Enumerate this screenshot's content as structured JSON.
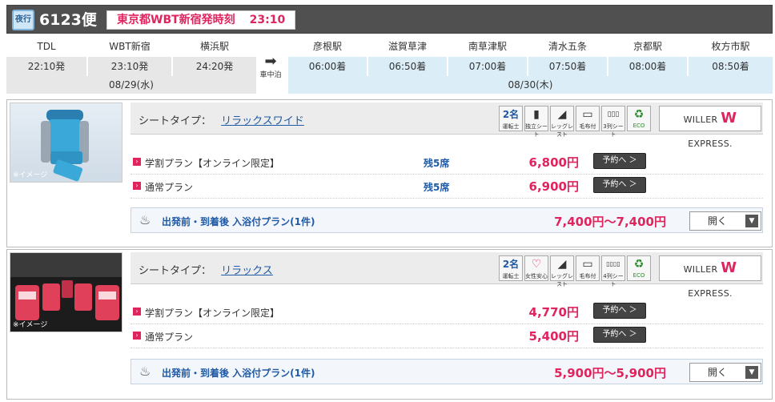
{
  "header": {
    "badge": "夜行",
    "flight": "6123便",
    "route": "東京都WBT新宿発時刻",
    "dep_time": "23:10"
  },
  "stops_dep": [
    {
      "name": "TDL",
      "time": "22:10発"
    },
    {
      "name": "WBT新宿",
      "time": "23:10発"
    },
    {
      "name": "横浜駅",
      "time": "24:20発"
    }
  ],
  "stops_arr": [
    {
      "name": "彦根駅",
      "time": "06:00着"
    },
    {
      "name": "滋賀草津",
      "time": "06:50着"
    },
    {
      "name": "南草津駅",
      "time": "07:00着"
    },
    {
      "name": "清水五条",
      "time": "07:50着"
    },
    {
      "name": "京都駅",
      "time": "08:00着"
    },
    {
      "name": "枚方市駅",
      "time": "08:50着"
    }
  ],
  "dep_date": "08/29(水)",
  "arr_date": "08/30(木)",
  "overnight_label": "車中泊",
  "image_caption": "※イメージ",
  "seat_type_label": "シートタイプ：",
  "reserve_label": "予約へ ＞",
  "open_label": "開く",
  "sections": [
    {
      "seat_type": "リラックスワイド",
      "icons": [
        {
          "name": "driver-2-icon",
          "label": "運転士",
          "glyph": "2名"
        },
        {
          "name": "private-seat-icon",
          "label": "独立シート",
          "glyph": "▮"
        },
        {
          "name": "leg-rest-icon",
          "label": "レッグレスト",
          "glyph": "◢"
        },
        {
          "name": "blanket-icon",
          "label": "毛布付",
          "glyph": "▭"
        },
        {
          "name": "3-row-seat-icon",
          "label": "3列シート",
          "glyph": "▯▯▯"
        },
        {
          "name": "eco-icon",
          "label": "ECO",
          "glyph": "♻"
        }
      ],
      "brand": "WILLER",
      "brand_w": "W",
      "brand_tail": "EXPRESS.",
      "plans": [
        {
          "name": "学割プラン【オンライン限定】",
          "seats": "残5席",
          "price": "6,800円"
        },
        {
          "name": "通常プラン",
          "seats": "残5席",
          "price": "6,900円"
        }
      ],
      "bath": {
        "title": "出発前・到着後 入浴付プラン(1件)",
        "price": "7,400円～7,400円"
      }
    },
    {
      "seat_type": "リラックス",
      "icons": [
        {
          "name": "driver-2-icon",
          "label": "運転士",
          "glyph": "2名"
        },
        {
          "name": "women-safe-icon",
          "label": "女性安心",
          "glyph": "♡"
        },
        {
          "name": "leg-rest-icon",
          "label": "レッグレスト",
          "glyph": "◢"
        },
        {
          "name": "blanket-icon",
          "label": "毛布付",
          "glyph": "▭"
        },
        {
          "name": "4-row-seat-icon",
          "label": "4列シート",
          "glyph": "▯▯▯▯"
        },
        {
          "name": "eco-icon",
          "label": "ECO",
          "glyph": "♻"
        }
      ],
      "brand": "WILLER",
      "brand_w": "W",
      "brand_tail": "EXPRESS.",
      "plans": [
        {
          "name": "学割プラン【オンライン限定】",
          "seats": "",
          "price": "4,770円"
        },
        {
          "name": "通常プラン",
          "seats": "",
          "price": "5,400円"
        }
      ],
      "bath": {
        "title": "出発前・到着後 入浴付プラン(1件)",
        "price": "5,900円～5,900円"
      }
    }
  ],
  "colors": {
    "accent": "#e0245e",
    "link": "#1f5aa6",
    "header_bg": "#505050"
  }
}
